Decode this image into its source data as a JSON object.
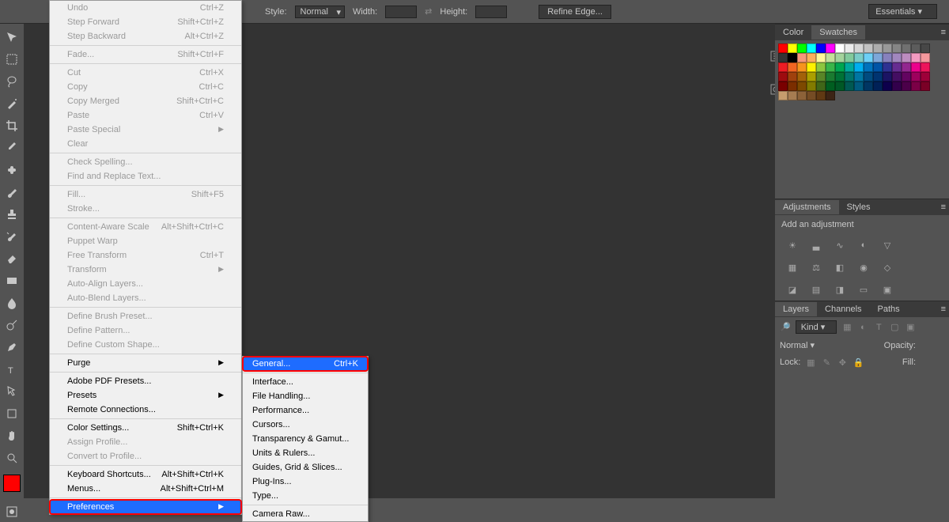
{
  "options_bar": {
    "style_label": "Style:",
    "style_value": "Normal",
    "width_label": "Width:",
    "height_label": "Height:",
    "refine_label": "Refine Edge...",
    "workspace": "Essentials"
  },
  "edit_menu": [
    {
      "label": "Undo",
      "shortcut": "Ctrl+Z",
      "disabled": true
    },
    {
      "label": "Step Forward",
      "shortcut": "Shift+Ctrl+Z",
      "disabled": true
    },
    {
      "label": "Step Backward",
      "shortcut": "Alt+Ctrl+Z",
      "disabled": true
    },
    {
      "sep": true
    },
    {
      "label": "Fade...",
      "shortcut": "Shift+Ctrl+F",
      "disabled": true
    },
    {
      "sep": true
    },
    {
      "label": "Cut",
      "shortcut": "Ctrl+X",
      "disabled": true
    },
    {
      "label": "Copy",
      "shortcut": "Ctrl+C",
      "disabled": true
    },
    {
      "label": "Copy Merged",
      "shortcut": "Shift+Ctrl+C",
      "disabled": true
    },
    {
      "label": "Paste",
      "shortcut": "Ctrl+V",
      "disabled": true
    },
    {
      "label": "Paste Special",
      "arrow": true,
      "disabled": true
    },
    {
      "label": "Clear",
      "disabled": true
    },
    {
      "sep": true
    },
    {
      "label": "Check Spelling...",
      "disabled": true
    },
    {
      "label": "Find and Replace Text...",
      "disabled": true
    },
    {
      "sep": true
    },
    {
      "label": "Fill...",
      "shortcut": "Shift+F5",
      "disabled": true
    },
    {
      "label": "Stroke...",
      "disabled": true
    },
    {
      "sep": true
    },
    {
      "label": "Content-Aware Scale",
      "shortcut": "Alt+Shift+Ctrl+C",
      "disabled": true
    },
    {
      "label": "Puppet Warp",
      "disabled": true
    },
    {
      "label": "Free Transform",
      "shortcut": "Ctrl+T",
      "disabled": true
    },
    {
      "label": "Transform",
      "arrow": true,
      "disabled": true
    },
    {
      "label": "Auto-Align Layers...",
      "disabled": true
    },
    {
      "label": "Auto-Blend Layers...",
      "disabled": true
    },
    {
      "sep": true
    },
    {
      "label": "Define Brush Preset...",
      "disabled": true
    },
    {
      "label": "Define Pattern...",
      "disabled": true
    },
    {
      "label": "Define Custom Shape...",
      "disabled": true
    },
    {
      "sep": true
    },
    {
      "label": "Purge",
      "arrow": true
    },
    {
      "sep": true
    },
    {
      "label": "Adobe PDF Presets..."
    },
    {
      "label": "Presets",
      "arrow": true
    },
    {
      "label": "Remote Connections..."
    },
    {
      "sep": true
    },
    {
      "label": "Color Settings...",
      "shortcut": "Shift+Ctrl+K"
    },
    {
      "label": "Assign Profile...",
      "disabled": true
    },
    {
      "label": "Convert to Profile...",
      "disabled": true
    },
    {
      "sep": true
    },
    {
      "label": "Keyboard Shortcuts...",
      "shortcut": "Alt+Shift+Ctrl+K"
    },
    {
      "label": "Menus...",
      "shortcut": "Alt+Shift+Ctrl+M"
    },
    {
      "sep": true
    },
    {
      "label": "Preferences",
      "arrow": true,
      "hover": true,
      "highlight": true
    }
  ],
  "prefs_submenu": [
    {
      "label": "General...",
      "shortcut": "Ctrl+K",
      "hover": true,
      "highlight": true
    },
    {
      "sep": true
    },
    {
      "label": "Interface..."
    },
    {
      "label": "File Handling..."
    },
    {
      "label": "Performance..."
    },
    {
      "label": "Cursors..."
    },
    {
      "label": "Transparency & Gamut..."
    },
    {
      "label": "Units & Rulers..."
    },
    {
      "label": "Guides, Grid & Slices..."
    },
    {
      "label": "Plug-Ins..."
    },
    {
      "label": "Type..."
    },
    {
      "sep": true
    },
    {
      "label": "Camera Raw..."
    }
  ],
  "panels": {
    "color_tab": "Color",
    "swatches_tab": "Swatches",
    "adjustments_tab": "Adjustments",
    "styles_tab": "Styles",
    "adjustments_text": "Add an adjustment",
    "layers_tab": "Layers",
    "channels_tab": "Channels",
    "paths_tab": "Paths",
    "kind_label": "Kind",
    "blend_mode": "Normal",
    "opacity_label": "Opacity:",
    "lock_label": "Lock:",
    "fill_label": "Fill:"
  },
  "swatch_colors": [
    "#ff0000",
    "#ffff00",
    "#00ff00",
    "#00ffff",
    "#0000ff",
    "#ff00ff",
    "#ffffff",
    "#ebebeb",
    "#d6d6d6",
    "#c2c2c2",
    "#adadad",
    "#999999",
    "#858585",
    "#707070",
    "#5c5c5c",
    "#474747",
    "#333333",
    "#000000",
    "#f7977a",
    "#fbaf5d",
    "#fff79a",
    "#c4df9b",
    "#a3d39c",
    "#82ca9c",
    "#7accc8",
    "#6dcff6",
    "#7da7d9",
    "#8781bd",
    "#a187be",
    "#bc8cbf",
    "#f49ac1",
    "#f5989d",
    "#ed1c24",
    "#f26522",
    "#f7941d",
    "#fff200",
    "#8dc63f",
    "#39b54a",
    "#00a651",
    "#00a99d",
    "#00aeef",
    "#0072bc",
    "#0054a6",
    "#2e3192",
    "#662d91",
    "#92278f",
    "#ec008c",
    "#ed145b",
    "#9e0b0f",
    "#a0410d",
    "#a36209",
    "#aba000",
    "#598527",
    "#1a7b30",
    "#007236",
    "#00746b",
    "#0076a3",
    "#004b80",
    "#003471",
    "#1b1464",
    "#440e62",
    "#630460",
    "#9e005d",
    "#9e0039",
    "#790000",
    "#7b2e00",
    "#7d4900",
    "#827b00",
    "#406618",
    "#005e20",
    "#005826",
    "#005952",
    "#005b7f",
    "#003663",
    "#002157",
    "#0d004c",
    "#32004b",
    "#4b0049",
    "#7b0046",
    "#7a0026",
    "#c69c6d",
    "#a67c52",
    "#8c6239",
    "#754c24",
    "#603913",
    "#3c2415"
  ]
}
